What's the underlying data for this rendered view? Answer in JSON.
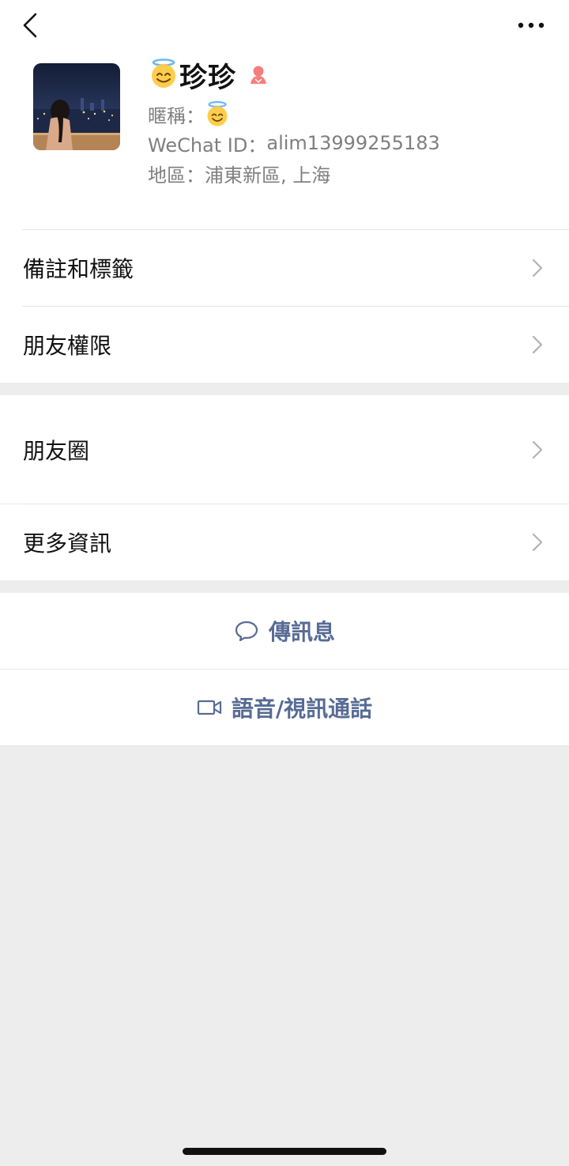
{
  "nav": {
    "back_icon": "chevron-left-icon",
    "more_icon": "more-horizontal-icon"
  },
  "profile": {
    "name": "珍珍",
    "name_emoji": "halo-smile-emoji",
    "gender_icon": "female-icon",
    "nickname_label": "暱稱：",
    "nickname_emoji": "halo-smile-emoji",
    "wechat_id_label": "WeChat ID：",
    "wechat_id": "alim13999255183",
    "region_label": "地區：",
    "region": "浦東新區, 上海"
  },
  "menu": {
    "group1": [
      {
        "label": "備註和標籤"
      },
      {
        "label": "朋友權限"
      }
    ],
    "group2": [
      {
        "label": "朋友圈"
      },
      {
        "label": "更多資訊"
      }
    ]
  },
  "actions": {
    "send_message": "傳訊息",
    "call": "語音/視訊通話"
  },
  "colors": {
    "accent": "#576b95",
    "background": "#ededed",
    "female": "#f37e7d"
  }
}
